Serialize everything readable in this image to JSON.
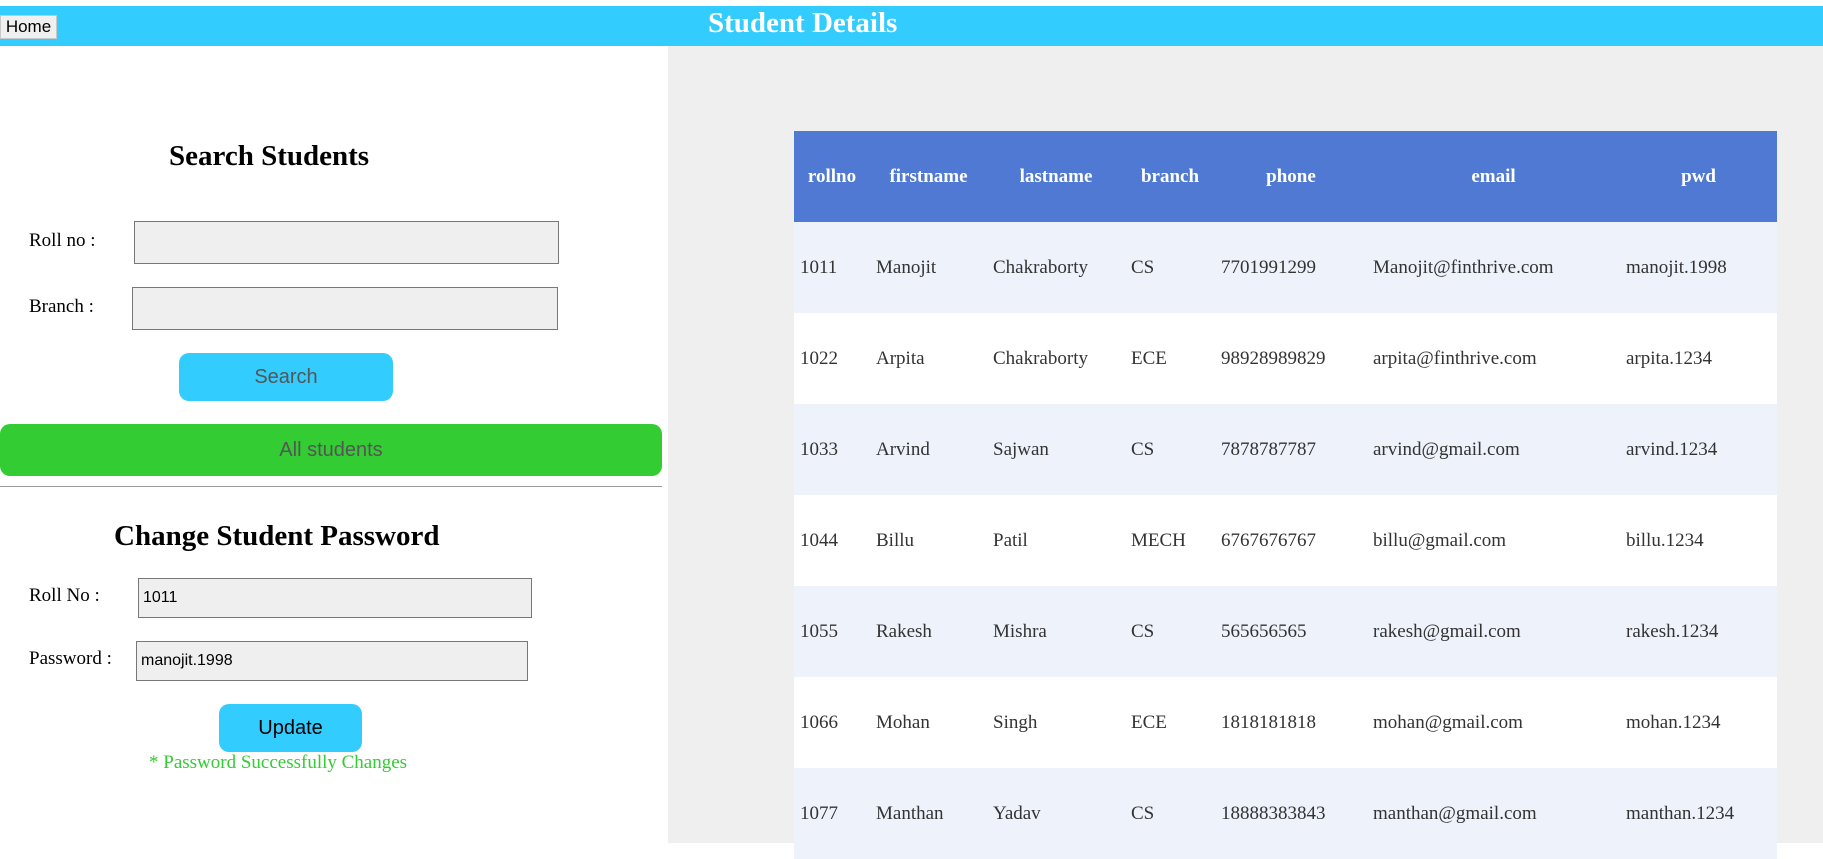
{
  "header": {
    "home_label": "Home",
    "title": "Student Details"
  },
  "search": {
    "title": "Search Students",
    "rollno_label": "Roll no :",
    "rollno_value": "",
    "branch_label": "Branch :",
    "branch_value": "",
    "search_label": "Search",
    "all_students_label": "All students"
  },
  "change_password": {
    "title": "Change Student Password",
    "rollno_label": "Roll No :",
    "rollno_value": "1011",
    "password_label": "Password :",
    "password_value": "manojit.1998",
    "update_label": "Update",
    "status_message": "* Password Successfully Changes"
  },
  "table": {
    "columns": [
      "rollno",
      "firstname",
      "lastname",
      "branch",
      "phone",
      "email",
      "pwd"
    ],
    "rows": [
      [
        "1011",
        "Manojit",
        "Chakraborty",
        "CS",
        "7701991299",
        "Manojit@finthrive.com",
        "manojit.1998"
      ],
      [
        "1022",
        "Arpita",
        "Chakraborty",
        "ECE",
        "98928989829",
        "arpita@finthrive.com",
        "arpita.1234"
      ],
      [
        "1033",
        "Arvind",
        "Sajwan",
        "CS",
        "7878787787",
        "arvind@gmail.com",
        "arvind.1234"
      ],
      [
        "1044",
        "Billu",
        "Patil",
        "MECH",
        "6767676767",
        "billu@gmail.com",
        "billu.1234"
      ],
      [
        "1055",
        "Rakesh",
        "Mishra",
        "CS",
        "565656565",
        "rakesh@gmail.com",
        "rakesh.1234"
      ],
      [
        "1066",
        "Mohan",
        "Singh",
        "ECE",
        "1818181818",
        "mohan@gmail.com",
        "mohan.1234"
      ],
      [
        "1077",
        "Manthan",
        "Yadav",
        "CS",
        "18888383843",
        "manthan@gmail.com",
        "manthan.1234"
      ]
    ]
  },
  "colors": {
    "header_bar": "#33ccff",
    "table_header": "#5079d3",
    "row_stripe": "#edf2fb",
    "all_students_button": "#33cc33",
    "success_text": "#33cc33",
    "right_panel_bg": "#efefef"
  }
}
